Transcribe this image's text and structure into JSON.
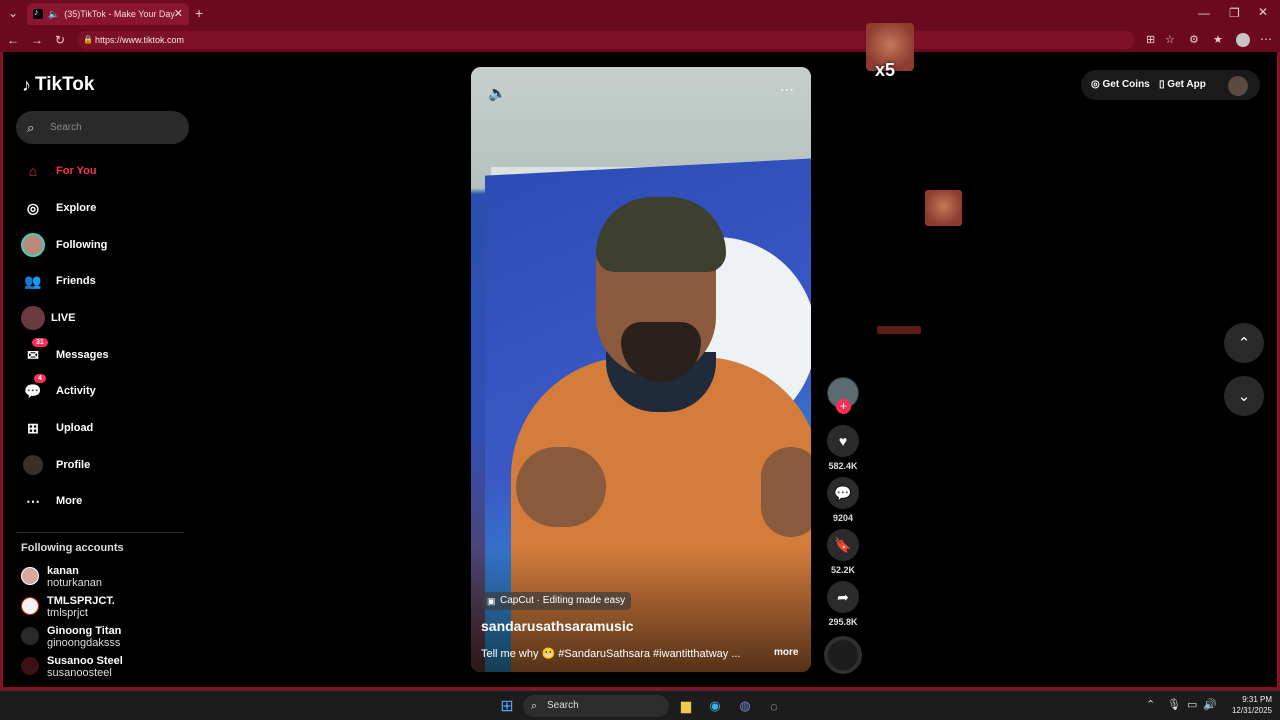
{
  "browser": {
    "tab_title": "(35)TikTok - Make Your Day",
    "url": "https://www.tiktok.com",
    "new_tab_icon": "+"
  },
  "brand": {
    "name": "TikTok"
  },
  "search": {
    "placeholder": "Search"
  },
  "nav": [
    {
      "label": "For You",
      "icon": "home-icon",
      "active": true
    },
    {
      "label": "Explore",
      "icon": "compass-icon"
    },
    {
      "label": "Following",
      "icon": "avatar"
    },
    {
      "label": "Friends",
      "icon": "friends-icon"
    },
    {
      "label": "LIVE",
      "icon": "live-avatar"
    },
    {
      "label": "Messages",
      "icon": "messages-icon",
      "badge": "31"
    },
    {
      "label": "Activity",
      "icon": "activity-icon",
      "badge": "4"
    },
    {
      "label": "Upload",
      "icon": "upload-icon"
    },
    {
      "label": "Profile",
      "icon": "profile-avatar"
    },
    {
      "label": "More",
      "icon": "more-icon"
    }
  ],
  "following_accounts": {
    "title": "Following accounts",
    "items": [
      {
        "name": "kanan",
        "handle": "noturkanan"
      },
      {
        "name": "TMLSPRJCT.",
        "handle": "tmlsprjct"
      },
      {
        "name": "Ginoong Titan",
        "handle": "ginoongdaksss"
      },
      {
        "name": "Susanoo Steel",
        "handle": "susanoosteel"
      }
    ]
  },
  "video": {
    "capcut_tag": "CapCut · Editing made easy",
    "creator": "sandarusathsaramusic",
    "caption": "Tell me why 😬 #SandaruSathsara #iwantitthatway ...",
    "more_label": "more"
  },
  "actions": {
    "likes": "582.4K",
    "comments": "9204",
    "saves": "52.2K",
    "shares": "295.8K"
  },
  "topbar": {
    "get_coins": "Get Coins",
    "get_app": "Get App"
  },
  "overlay": {
    "multiplier": "x5"
  },
  "taskbar": {
    "search_label": "Search",
    "time": "9:31 PM",
    "date": "12/31/2025"
  },
  "colors": {
    "accent": "#fe2c55",
    "chrome": "#6b0a1e"
  }
}
